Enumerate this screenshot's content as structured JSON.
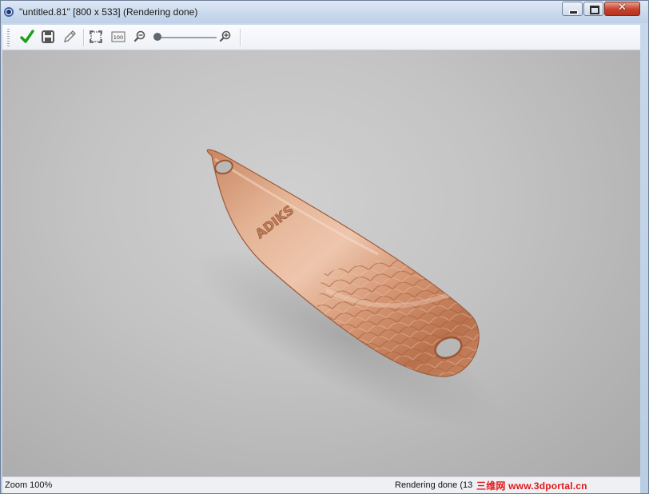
{
  "window": {
    "title": "\"untitled.81\" [800 x 533] (Rendering done)"
  },
  "toolbar": {
    "items": [
      {
        "name": "accept-checkmark",
        "icon": "check-icon",
        "color": "#1aa81a"
      },
      {
        "name": "save",
        "icon": "floppy-disk-icon"
      },
      {
        "name": "edit",
        "icon": "pencil-icon"
      },
      {
        "name": "fit",
        "icon": "fit-to-window-icon"
      },
      {
        "name": "actual-size",
        "icon": "actual-size-100-icon",
        "label": "100"
      },
      {
        "name": "zoom-out",
        "icon": "zoom-out-icon"
      },
      {
        "name": "zoom-in",
        "icon": "zoom-in-icon"
      }
    ],
    "zoom_slider_level": 0.0
  },
  "viewport": {
    "object": "copper fishing spoon lure",
    "engraving": "ADIKS",
    "colors": {
      "background": "#c4c4c4",
      "copper": "#d79a78"
    }
  },
  "status": {
    "zoom": "Zoom 100%",
    "render_status": "Rendering done (13",
    "watermark": "三维网 www.3dportal.cn"
  }
}
